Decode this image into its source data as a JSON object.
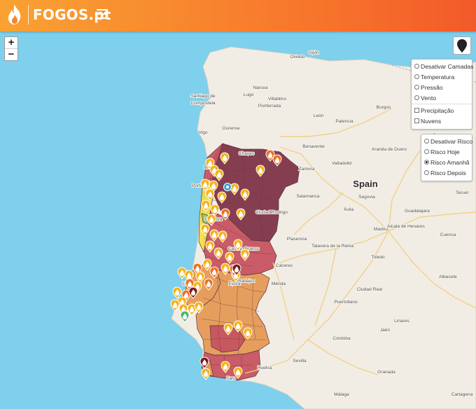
{
  "header": {
    "brand": "FOGOS.pt"
  },
  "map": {
    "zoom_in": "+",
    "zoom_out": "−",
    "labels": [
      {
        "text": "Spain",
        "big": true
      },
      {
        "text": "Madrid"
      },
      {
        "text": "Bilbao"
      },
      {
        "text": "Lugo"
      },
      {
        "text": "Santiago de"
      },
      {
        "text": "Compostela"
      },
      {
        "text": "Vigo"
      },
      {
        "text": "Ourense"
      },
      {
        "text": "León"
      },
      {
        "text": "Burgos"
      },
      {
        "text": "Valladolid"
      },
      {
        "text": "Zamora"
      },
      {
        "text": "Salamanca"
      },
      {
        "text": "Segovia"
      },
      {
        "text": "Ávila"
      },
      {
        "text": "Guadalajara"
      },
      {
        "text": "Toledo"
      },
      {
        "text": "Cáceres"
      },
      {
        "text": "Mérida"
      },
      {
        "text": "Badajoz"
      },
      {
        "text": "Ciudad Real"
      },
      {
        "text": "Córdoba"
      },
      {
        "text": "Sevilla"
      },
      {
        "text": "Huelva"
      },
      {
        "text": "Jaén"
      },
      {
        "text": "Granada"
      },
      {
        "text": "Málaga"
      },
      {
        "text": "Palencia"
      },
      {
        "text": "Soria"
      },
      {
        "text": "Albacete"
      },
      {
        "text": "Cuenca"
      },
      {
        "text": "Puertollano"
      },
      {
        "text": "Plasencia"
      },
      {
        "text": "Ponferrada"
      },
      {
        "text": "Oviedo"
      },
      {
        "text": "Gijón"
      },
      {
        "text": "Chaves"
      },
      {
        "text": "Braga"
      },
      {
        "text": "Porto"
      },
      {
        "text": "Coimbra"
      },
      {
        "text": "Lisboa"
      },
      {
        "text": "Castelo Branco"
      },
      {
        "text": "Évora"
      },
      {
        "text": "Faro"
      },
      {
        "text": "Linares"
      },
      {
        "text": "Ciudad Rodrigo"
      },
      {
        "text": "Aranda de Duero"
      },
      {
        "text": "Talavera de la Reina"
      },
      {
        "text": "Alcalá de Henares"
      },
      {
        "text": "Teruel"
      },
      {
        "text": "Cartagena"
      },
      {
        "text": "Narcea"
      },
      {
        "text": "Villablino"
      },
      {
        "text": "Benavente"
      }
    ]
  },
  "layers_panel": {
    "items": [
      {
        "label": "Desativar Camadas",
        "kind": "radio",
        "on": false
      },
      {
        "label": "Temperatura",
        "kind": "radio",
        "on": false
      },
      {
        "label": "Pressão",
        "kind": "radio",
        "on": false
      },
      {
        "label": "Vento",
        "kind": "radio",
        "on": false
      },
      {
        "label": "Precipitação",
        "kind": "check",
        "on": false
      },
      {
        "label": "Nuvens",
        "kind": "check",
        "on": false
      }
    ]
  },
  "risk_panel": {
    "items": [
      {
        "label": "Desativar Risco",
        "on": false
      },
      {
        "label": "Risco Hoje",
        "on": false
      },
      {
        "label": "Risco Amanhã",
        "on": true
      },
      {
        "label": "Risco Depois",
        "on": false
      }
    ]
  },
  "colors": {
    "sea": "#7ed0ec",
    "land": "#f1ede4",
    "risk_maximum": "#7e3548",
    "risk_very_high": "#c6545f",
    "risk_high": "#e49a55",
    "risk_moderate": "#f2e04a",
    "risk_low": "#8fcf6a",
    "fire_yellow": "#f6b21a",
    "fire_orange": "#ef6f1e",
    "fire_dark": "#7b1a1a"
  }
}
